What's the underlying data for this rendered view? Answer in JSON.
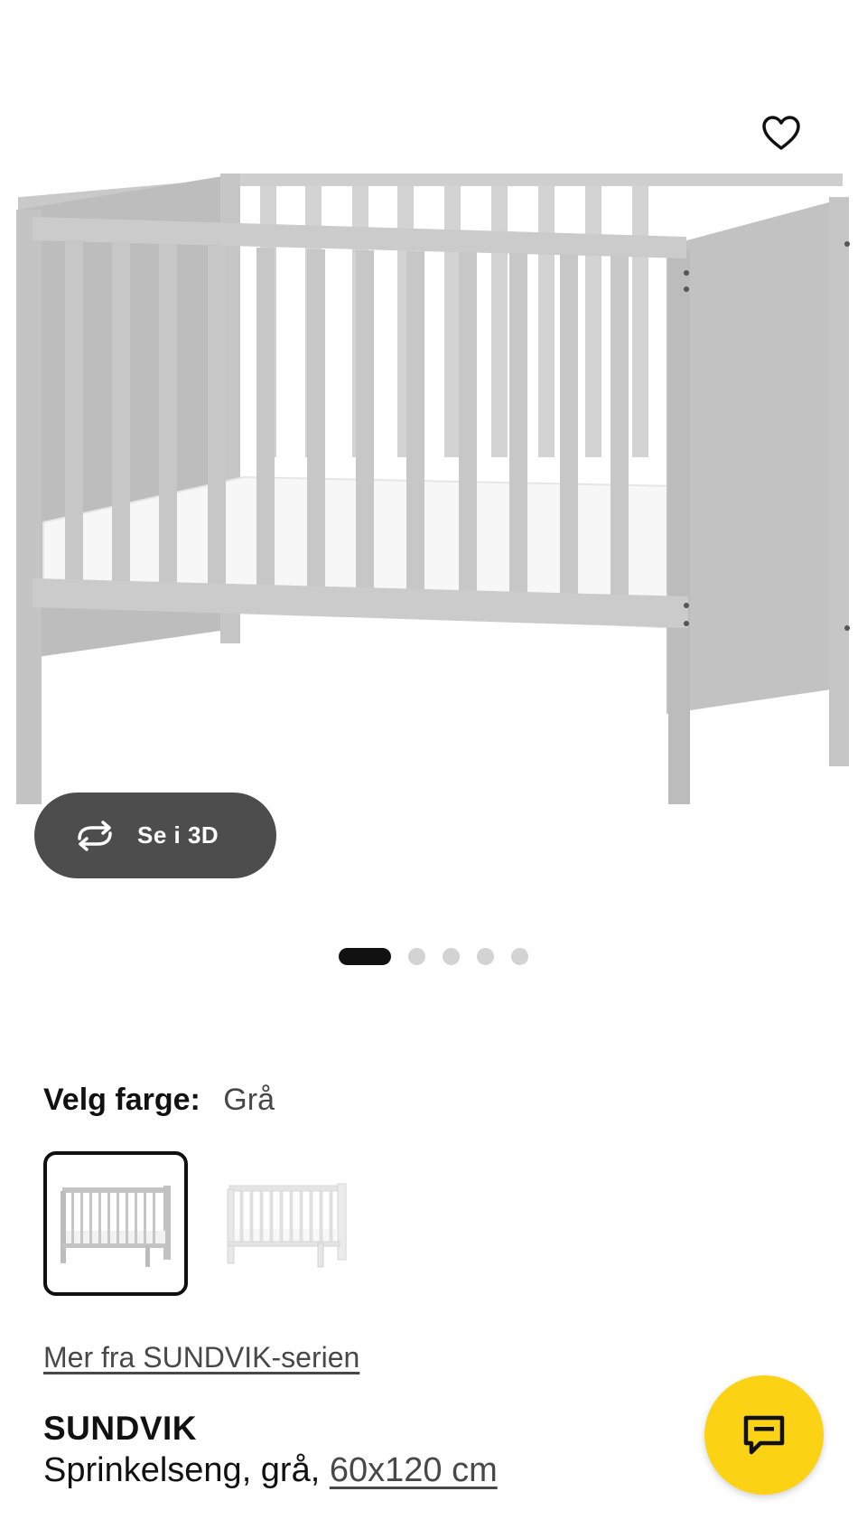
{
  "hero": {
    "product_image": "crib-grey-image",
    "favorite_icon": "heart-outline-icon",
    "view_3d": {
      "icon": "rotate-3d-icon",
      "label": "Se i 3D"
    },
    "carousel": {
      "total": 5,
      "active_index": 0
    }
  },
  "color_picker": {
    "label": "Velg farge:",
    "selected_value": "Grå",
    "options": [
      {
        "name": "grey-crib-thumbnail",
        "selected": true
      },
      {
        "name": "white-crib-thumbnail",
        "selected": false
      }
    ]
  },
  "series_link": "Mer fra SUNDVIK-serien",
  "product": {
    "name": "SUNDVIK",
    "description": "Sprinkelseng, grå,",
    "size": "60x120 cm"
  },
  "chat_button": {
    "icon": "chat-bubble-icon"
  },
  "colors": {
    "accent_yellow": "#fcd214",
    "button_dark": "#4d4d4d",
    "text": "#111111"
  }
}
